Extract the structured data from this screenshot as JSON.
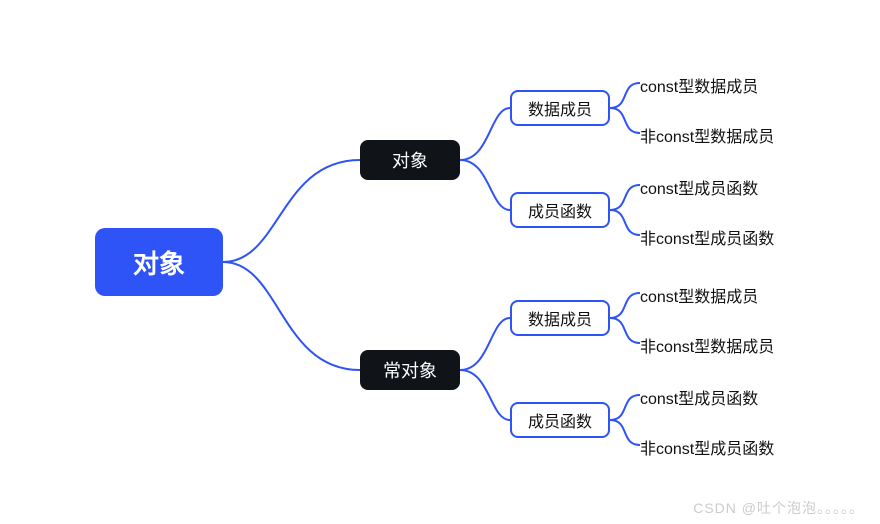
{
  "root": {
    "label": "对象"
  },
  "level2": [
    {
      "label": "对象"
    },
    {
      "label": "常对象"
    }
  ],
  "level3": [
    {
      "label": "数据成员"
    },
    {
      "label": "成员函数"
    },
    {
      "label": "数据成员"
    },
    {
      "label": "成员函数"
    }
  ],
  "leaves": [
    "const型数据成员",
    "非const型数据成员",
    "const型成员函数",
    "非const型成员函数",
    "const型数据成员",
    "非const型数据成员",
    "const型成员函数",
    "非const型成员函数"
  ],
  "watermark": "CSDN @吐个泡泡。。。。。"
}
